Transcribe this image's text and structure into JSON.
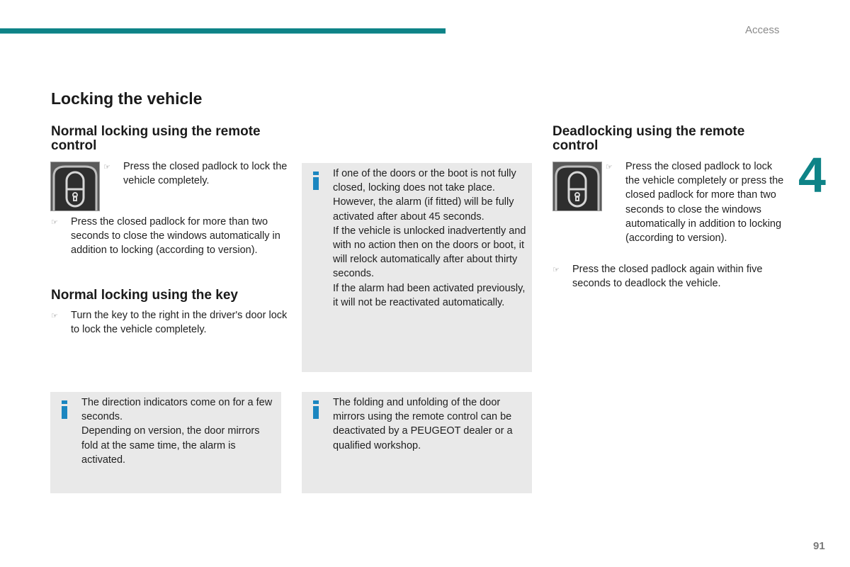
{
  "header": {
    "section_label": "Access",
    "accent_color": "#0e8387"
  },
  "chapter_number": "4",
  "page_number": "91",
  "page_title": "Locking the vehicle",
  "normal_remote": {
    "heading": "Normal locking using the remote control",
    "bullets": [
      "Press the closed padlock to lock the vehicle completely.",
      "Press the closed padlock for more than two seconds to close the windows automatically in addition to locking (according to version)."
    ]
  },
  "normal_key": {
    "heading": "Normal locking using the key",
    "bullets": [
      "Turn the key to the right in the driver's door lock to lock the vehicle completely."
    ]
  },
  "deadlocking": {
    "heading": "Deadlocking using the remote control",
    "bullets": [
      "Press the closed padlock to lock the vehicle completely or press the closed padlock for more than two seconds to close the windows automatically in addition to locking (according to version).",
      "Press the closed padlock again within five seconds to deadlock the vehicle."
    ]
  },
  "info_boxes": [
    {
      "paragraphs": [
        "If one of the doors or the boot is not fully closed, locking does not take place.",
        "However, the alarm (if fitted) will be fully activated after about 45 seconds.",
        "If the vehicle is unlocked inadvertently and with no action then on the doors or boot, it will relock automatically after about thirty seconds.",
        "If the alarm had been activated previously, it will not be reactivated automatically."
      ]
    },
    {
      "paragraphs": [
        "The direction indicators come on for a few seconds.",
        "Depending on version, the door mirrors fold at the same time, the alarm is activated."
      ]
    },
    {
      "paragraphs": [
        "The folding and unfolding of the door mirrors using the remote control can be deactivated by a PEUGEOT dealer or a qualified workshop."
      ]
    }
  ],
  "icons": {
    "bullet": "☞",
    "info": "info-icon",
    "padlock": "padlock-button-icon"
  }
}
